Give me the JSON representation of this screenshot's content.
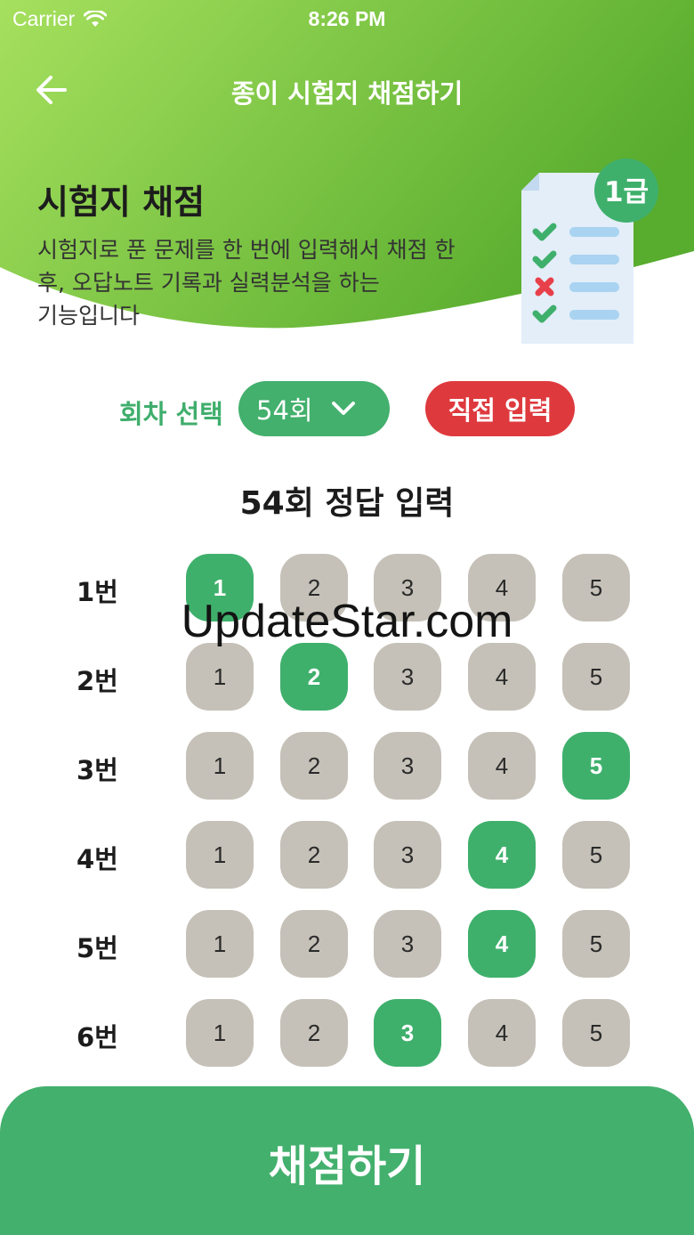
{
  "status_bar": {
    "carrier": "Carrier",
    "time": "8:26 PM"
  },
  "nav": {
    "title": "종이 시험지 채점하기",
    "back_icon": "arrow-left-icon"
  },
  "hero": {
    "title": "시험지 채점",
    "description": "시험지로 푼 문제를 한 번에 입력해서 채점 한 후, 오답노트 기록과 실력분석을 하는 기능입니다",
    "badge": "1급",
    "checklist": [
      "correct",
      "correct",
      "wrong",
      "correct"
    ]
  },
  "round": {
    "label": "회차 선택",
    "value": "54회",
    "direct_input": "직접 입력"
  },
  "answer_title": "54회 정답 입력",
  "questions": [
    {
      "label": "1번",
      "options": [
        "1",
        "2",
        "3",
        "4",
        "5"
      ],
      "selected": 1
    },
    {
      "label": "2번",
      "options": [
        "1",
        "2",
        "3",
        "4",
        "5"
      ],
      "selected": 2
    },
    {
      "label": "3번",
      "options": [
        "1",
        "2",
        "3",
        "4",
        "5"
      ],
      "selected": 5
    },
    {
      "label": "4번",
      "options": [
        "1",
        "2",
        "3",
        "4",
        "5"
      ],
      "selected": 4
    },
    {
      "label": "5번",
      "options": [
        "1",
        "2",
        "3",
        "4",
        "5"
      ],
      "selected": 4
    },
    {
      "label": "6번",
      "options": [
        "1",
        "2",
        "3",
        "4",
        "5"
      ],
      "selected": 3
    }
  ],
  "watermark": "UpdateStar.com",
  "grade_button": "채점하기",
  "colors": {
    "accent": "#43b06d",
    "danger": "#de3a3e",
    "option_bg": "#c5c1b8",
    "hero_start": "#a6e05e",
    "hero_end": "#5aae30"
  }
}
